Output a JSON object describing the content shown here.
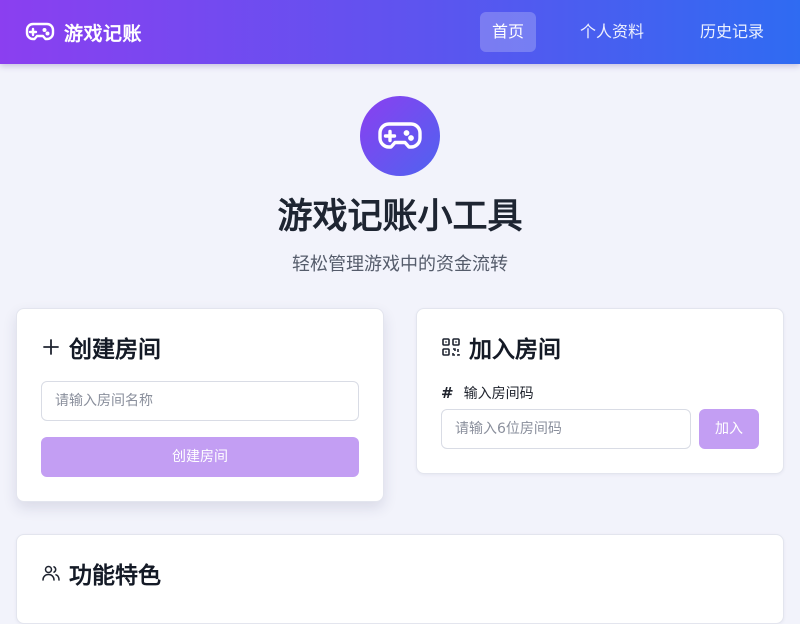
{
  "nav": {
    "brand": "游戏记账",
    "items": [
      {
        "label": "首页",
        "active": true
      },
      {
        "label": "个人资料",
        "active": false
      },
      {
        "label": "历史记录",
        "active": false
      }
    ]
  },
  "hero": {
    "icon": "gamepad-icon",
    "title": "游戏记账小工具",
    "subtitle": "轻松管理游戏中的资金流转"
  },
  "create_room": {
    "icon": "plus-icon",
    "title": "创建房间",
    "input_placeholder": "请输入房间名称",
    "button_label": "创建房间"
  },
  "join_room": {
    "icon": "qr-code-icon",
    "title": "加入房间",
    "field_label": "输入房间码",
    "input_placeholder": "请输入6位房间码",
    "button_label": "加入"
  },
  "features": {
    "icon": "users-icon",
    "title": "功能特色"
  },
  "colors": {
    "nav_gradient_start": "#8b3ff0",
    "nav_gradient_end": "#2f6bf2",
    "button_disabled": "#c39ef3",
    "background": "#f2f3fb"
  }
}
